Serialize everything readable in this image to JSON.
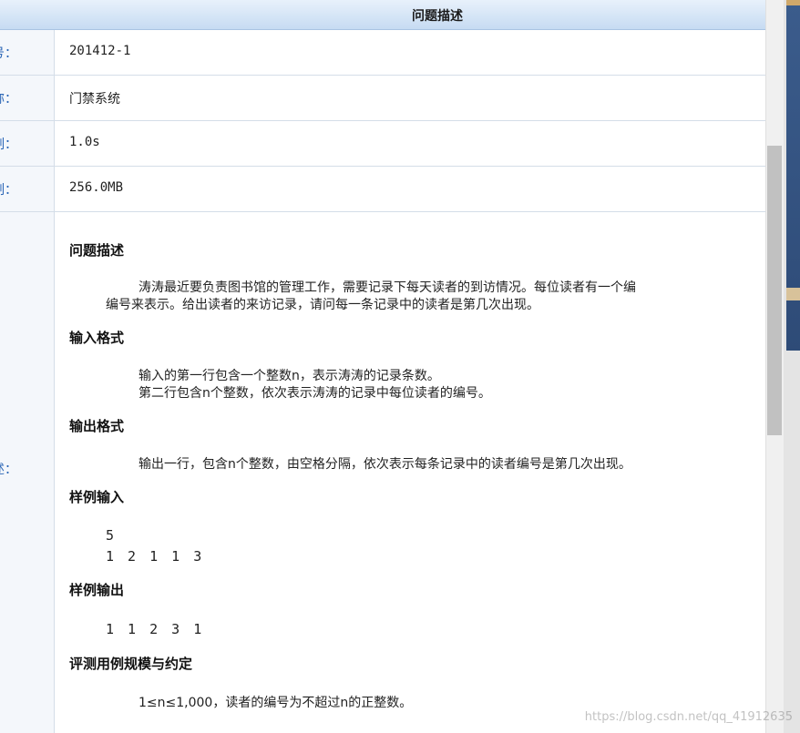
{
  "header": {
    "title": "问题描述"
  },
  "info_rows": [
    {
      "label": "号：",
      "value": "201412-1"
    },
    {
      "label": "称：",
      "value": "门禁系统"
    },
    {
      "label": "制：",
      "value": "1.0s"
    },
    {
      "label": "制：",
      "value": "256.0MB"
    }
  ],
  "description_label": "述：",
  "problem": {
    "desc_heading": "问题描述",
    "desc_line1": "涛涛最近要负责图书馆的管理工作，需要记录下每天读者的到访情况。每位读者有一个编",
    "desc_line2": "编号来表示。给出读者的来访记录，请问每一条记录中的读者是第几次出现。",
    "input_heading": "输入格式",
    "input_line1": "输入的第一行包含一个整数n，表示涛涛的记录条数。",
    "input_line2": "第二行包含n个整数，依次表示涛涛的记录中每位读者的编号。",
    "output_heading": "输出格式",
    "output_line1": "输出一行，包含n个整数，由空格分隔，依次表示每条记录中的读者编号是第几次出现。",
    "sample_input_heading": "样例输入",
    "sample_input_line1": "5",
    "sample_input_line2": "1 2 1 1 3",
    "sample_output_heading": "样例输出",
    "sample_output_line1": "1 1 2 3 1",
    "constraints_heading": "评测用例规模与约定",
    "constraints_line1": "1≤n≤1,000，读者的编号为不超过n的正整数。"
  },
  "watermark": "https://blog.csdn.net/qq_41912635"
}
